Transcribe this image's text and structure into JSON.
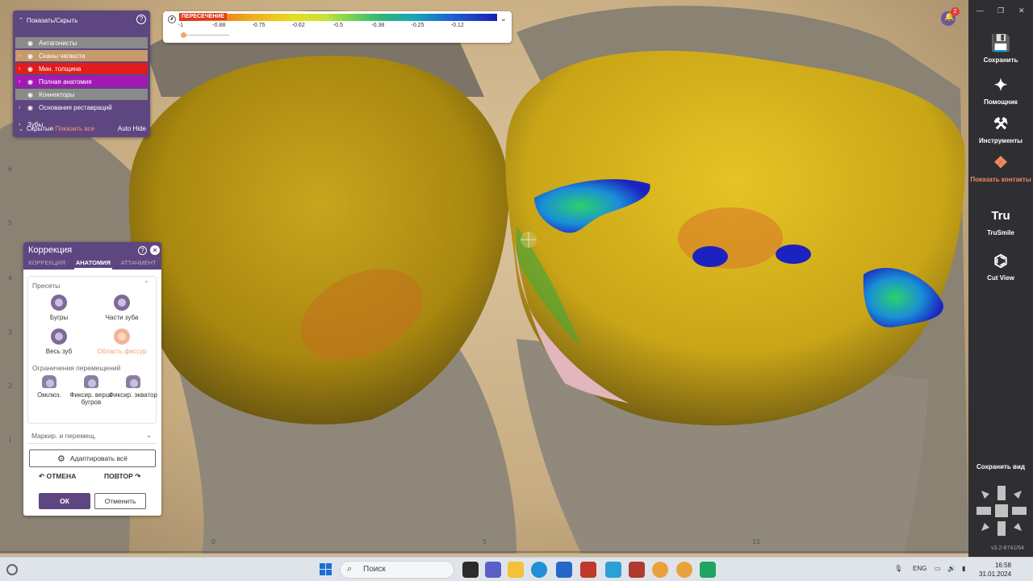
{
  "colors": {
    "panel_purple": "#5e4680",
    "accent_orange": "#f28a5c",
    "toolbar_dark": "#2f2f33"
  },
  "scale": {
    "title": "ПЕРЕСЕЧЕНИЕ",
    "ticks": [
      "-1",
      "-0.88",
      "-0.75",
      "-0.62",
      "-0.5",
      "-0.38",
      "-0.25",
      "-0.12"
    ],
    "icon": "gauge-icon",
    "toggle_icon": "chevron-down-icon"
  },
  "visibility": {
    "title": "Показать/Скрыть",
    "items": [
      {
        "label": "Антагонисты",
        "bg": "#8a8a8a",
        "has_arrow": false
      },
      {
        "label": "Сканы челюсти",
        "bg": "#c79a6a",
        "has_arrow": true
      },
      {
        "label": "Мин. толщина",
        "bg": "#e01c1c",
        "has_arrow": true
      },
      {
        "label": "Полная анатомия",
        "bg": "#a318b5",
        "has_arrow": true
      },
      {
        "label": "Коннекторы",
        "bg": "#8a8a8a",
        "has_arrow": false
      },
      {
        "label": "Основания реставраций",
        "bg": "",
        "has_arrow": true
      }
    ],
    "teeth_label": "Зубы",
    "hidden_label": "Скрытые",
    "show_all": "Показать все",
    "auto_hide": "Auto Hide"
  },
  "correction": {
    "title": "Коррекция",
    "tabs": [
      "КОРРЕКЦИЯ",
      "АНАТОМИЯ",
      "АТТАЧМЕНТ"
    ],
    "active_tab": "АНАТОМИЯ",
    "presets_label": "Пресеты",
    "presets": [
      "Бугры",
      "Части зуба",
      "Весь зуб",
      "Область фиссур"
    ],
    "limits_label": "Ограничения перемещений",
    "limits": [
      "Окклюз.",
      "Фиксир. верш. бугров",
      "Фиксир. экватор"
    ],
    "mark_move": "Маркир. и перемещ.",
    "adapt_all": "Адаптировать всё",
    "undo": "ОТМЕНА",
    "redo": "ПОВТОР",
    "ok": "ОК",
    "cancel": "Отменить"
  },
  "notifications": {
    "count": "2"
  },
  "toolbar": {
    "items": [
      {
        "label": "Сохранить",
        "icon": "save-icon",
        "glyph": "💾"
      },
      {
        "label": "Помощник",
        "icon": "magic-wand-icon",
        "glyph": "✦"
      },
      {
        "label": "Инструменты",
        "icon": "tools-icon",
        "glyph": "⚒"
      },
      {
        "label": "Показать контакты",
        "icon": "contacts-icon",
        "glyph": "❖"
      },
      {
        "label": "TruSmile",
        "icon": "trusmile-icon",
        "glyph": "Tru"
      },
      {
        "label": "Cut View",
        "icon": "cut-view-icon",
        "glyph": "⌬"
      }
    ],
    "save_view": "Сохранить вид",
    "version": "v3.2-8741/64"
  },
  "taskbar": {
    "search_placeholder": "Поиск",
    "lang": "ENG",
    "time": "16:58",
    "date": "31.01.2024"
  },
  "viewport": {
    "ruler_labels": [
      "6",
      "5",
      "4",
      "3",
      "2",
      "1",
      "0",
      "5",
      "10"
    ]
  }
}
